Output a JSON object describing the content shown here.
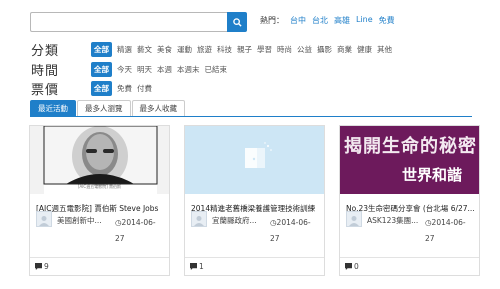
{
  "search": {
    "placeholder": ""
  },
  "hot": {
    "label": "熱門：",
    "links": [
      "台中",
      "台北",
      "高雄",
      "Line",
      "免費"
    ]
  },
  "filters": {
    "category": {
      "title": "分類",
      "selected": "全部",
      "options": [
        "精選",
        "藝文",
        "美食",
        "運動",
        "旅遊",
        "科技",
        "親子",
        "學習",
        "時尚",
        "公益",
        "攝影",
        "商業",
        "健康",
        "其他"
      ]
    },
    "time": {
      "title": "時間",
      "selected": "全部",
      "options": [
        "今天",
        "明天",
        "本週",
        "本週末",
        "已結束"
      ]
    },
    "price": {
      "title": "票價",
      "selected": "全部",
      "options": [
        "免費",
        "付費"
      ]
    }
  },
  "tabs": [
    "最近活動",
    "最多人瀏覽",
    "最多人收藏"
  ],
  "cards": [
    {
      "title": "[AIC週五電影院] 賈伯斯 Steve Jobs",
      "org": "美國創新中...",
      "date_line1": "2014-06-",
      "date_line2": "27",
      "count": "9",
      "thumb_caption": "[AIC週五電影院] 賈伯斯"
    },
    {
      "title": "2014精進老舊橋梁養護管理技術訓練",
      "org": "宜蘭縣政府...",
      "date_line1": "2014-06-",
      "date_line2": "27",
      "count": "1"
    },
    {
      "title": "No.23生命密碼分享會 (台北場 6/27...",
      "org": "ASK123集團...",
      "date_line1": "2014-06-",
      "date_line2": "27",
      "count": "0",
      "banner_line1": "揭開生命的秘密",
      "banner_line2": "世界和諧"
    }
  ],
  "colors": {
    "accent": "#1f7fc9",
    "placeholder_bg": "#cde6f5",
    "banner_bg": "#6d1a5c"
  }
}
